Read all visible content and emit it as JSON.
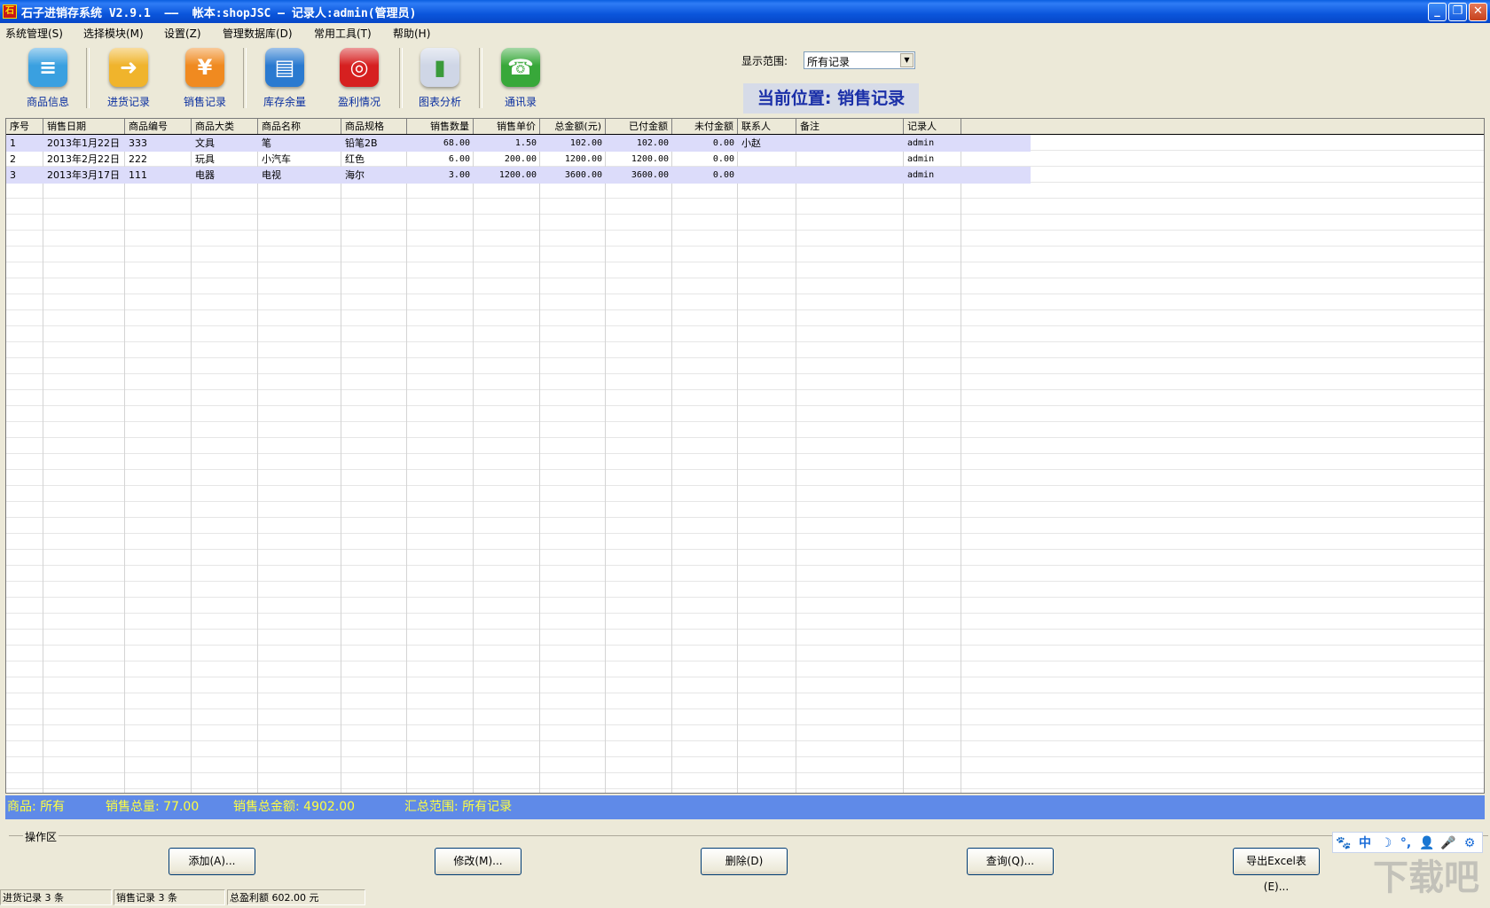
{
  "window": {
    "title": "石子进销存系统 V2.9.1  ——  帐本:shopJSC — 记录人:admin(管理员)",
    "app_icon_char": "石"
  },
  "menu": [
    "系统管理(S)",
    "选择模块(M)",
    "设置(Z)",
    "管理数据库(D)",
    "常用工具(T)",
    "帮助(H)"
  ],
  "toolbar": [
    {
      "label": "商品信息",
      "icon": "document-icon",
      "color": "#3aa0e0",
      "glyph": "≡"
    },
    {
      "label": "进货记录",
      "icon": "box-in-icon",
      "color": "#f0b42c",
      "glyph": "➜"
    },
    {
      "label": "销售记录",
      "icon": "yen-out-icon",
      "color": "#f08a20",
      "glyph": "¥"
    },
    {
      "label": "库存余量",
      "icon": "inventory-icon",
      "color": "#2a7ad0",
      "glyph": "▤"
    },
    {
      "label": "盈利情况",
      "icon": "coins-icon",
      "color": "#d62020",
      "glyph": "◎"
    },
    {
      "label": "图表分析",
      "icon": "bar-chart-icon",
      "color": "#cfd6e6",
      "glyph": "▮"
    },
    {
      "label": "通讯录",
      "icon": "telephone-icon",
      "color": "#38a83a",
      "glyph": "☎"
    }
  ],
  "range": {
    "label": "显示范围:",
    "value": "所有记录"
  },
  "location": "当前位置: 销售记录",
  "table": {
    "columns": [
      "序号",
      "销售日期",
      "商品编号",
      "商品大类",
      "商品名称",
      "商品规格",
      "销售数量",
      "销售单价",
      "总金额(元)",
      "已付金额",
      "未付金额",
      "联系人",
      "备注",
      "记录人"
    ],
    "rows": [
      [
        "1",
        "2013年1月22日",
        "333",
        "文具",
        "笔",
        "铅笔2B",
        "68.00",
        "1.50",
        "102.00",
        "102.00",
        "0.00",
        "小赵",
        "",
        "admin"
      ],
      [
        "2",
        "2013年2月22日",
        "222",
        "玩具",
        "小汽车",
        "红色",
        "6.00",
        "200.00",
        "1200.00",
        "1200.00",
        "0.00",
        "",
        "",
        "admin"
      ],
      [
        "3",
        "2013年3月17日",
        "111",
        "电器",
        "电视",
        "海尔",
        "3.00",
        "1200.00",
        "3600.00",
        "3600.00",
        "0.00",
        "",
        "",
        "admin"
      ]
    ]
  },
  "summary": {
    "product": "商品: 所有",
    "total_qty": "销售总量: 77.00",
    "total_amount": "销售总金额: 4902.00",
    "scope": "汇总范围: 所有记录"
  },
  "ops": {
    "group_label": "操作区",
    "buttons": [
      "添加(A)...",
      "修改(M)...",
      "删除(D)",
      "查询(Q)...",
      "导出Excel表(E)..."
    ]
  },
  "status": [
    "进货记录 3 条",
    "销售记录 3 条",
    "总盈利额 602.00 元"
  ],
  "ime": [
    "🐾",
    "中",
    "☽",
    "°,",
    "👤",
    "🎤",
    "⚙"
  ],
  "watermark": "下载吧"
}
